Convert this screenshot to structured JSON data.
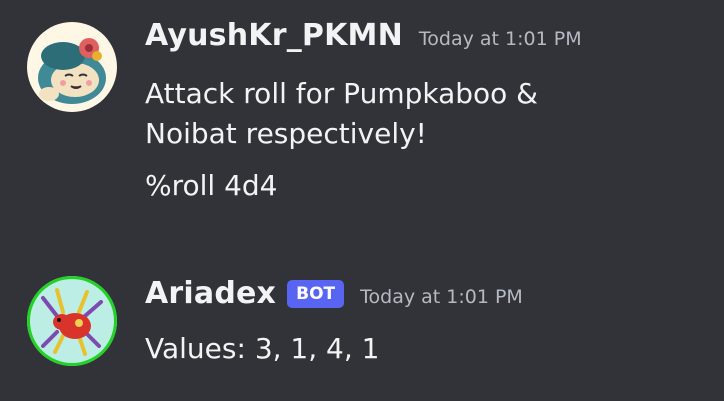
{
  "messages": [
    {
      "author": "AyushKr_PKMN",
      "timestamp": "Today at 1:01 PM",
      "avatar_icon": "snorlax-avatar",
      "lines": [
        "Attack roll for Pumpkaboo &",
        "Noibat respectively!",
        "%roll 4d4"
      ]
    },
    {
      "author": "Ariadex",
      "badge": "BOT",
      "timestamp": "Today at 1:01 PM",
      "avatar_icon": "ariados-avatar",
      "lines": [
        "Values: 3, 1, 4, 1"
      ]
    }
  ],
  "colors": {
    "background": "#313338",
    "bot_badge": "#5865f2",
    "bot_avatar_ring": "#23d323",
    "timestamp": "#b5bac1",
    "text": "#f2f3f5"
  }
}
